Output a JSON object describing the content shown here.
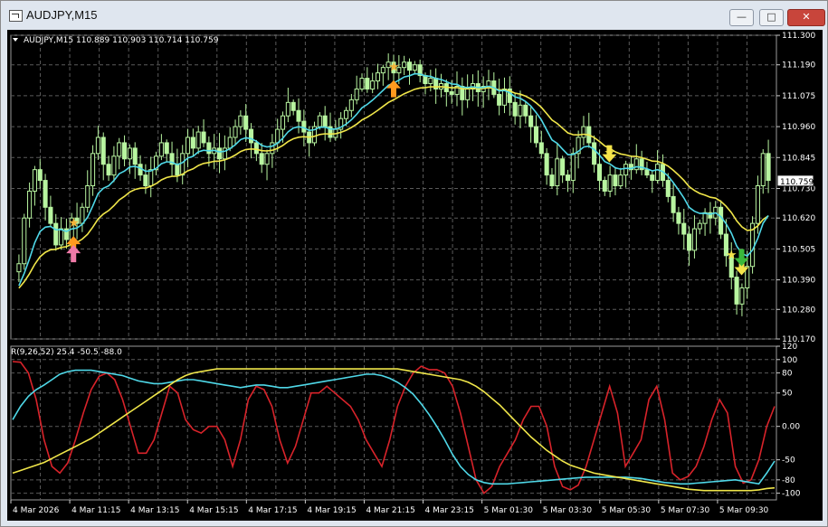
{
  "window": {
    "title": "AUDJPY,M15",
    "buttons": [
      "minimize",
      "maximize",
      "close"
    ]
  },
  "colors": {
    "background": "#000000",
    "grid": "#5a5a5a",
    "candle_up": "#b8f5a0",
    "ma_fast": "#4fd8e8",
    "ma_slow": "#f0e64a",
    "osc_red": "#d8232a",
    "osc_cyan": "#4fd8e8",
    "osc_yellow": "#f0e64a",
    "price_tag_bg": "#ffffff"
  },
  "chart_data": [
    {
      "type": "candlestick",
      "header": "AUDJPY,M15  110.889 110.903 110.714 110.759",
      "current_price": "110.759",
      "y_ticks": [
        "111.300",
        "111.190",
        "111.075",
        "110.960",
        "110.845",
        "110.730",
        "110.620",
        "110.505",
        "110.390",
        "110.280",
        "110.170"
      ],
      "ylim": [
        110.17,
        111.3
      ],
      "x_ticks": [
        "4 Mar 2026",
        "4 Mar 11:15",
        "4 Mar 13:15",
        "4 Mar 15:15",
        "4 Mar 17:15",
        "4 Mar 19:15",
        "4 Mar 21:15",
        "4 Mar 23:15",
        "5 Mar 01:30",
        "5 Mar 03:30",
        "5 Mar 05:30",
        "5 Mar 07:30",
        "5 Mar 09:30"
      ],
      "closes": [
        110.45,
        110.62,
        110.72,
        110.8,
        110.76,
        110.66,
        110.6,
        110.52,
        110.58,
        110.54,
        110.62,
        110.6,
        110.66,
        110.74,
        110.86,
        110.92,
        110.82,
        110.78,
        110.85,
        110.9,
        110.84,
        110.88,
        110.82,
        110.78,
        110.74,
        110.8,
        110.85,
        110.9,
        110.86,
        110.82,
        110.78,
        110.86,
        110.92,
        110.88,
        110.94,
        110.9,
        110.86,
        110.88,
        110.84,
        110.88,
        110.92,
        110.96,
        111.0,
        110.95,
        110.9,
        110.86,
        110.82,
        110.86,
        110.9,
        110.95,
        111.0,
        111.05,
        111.02,
        110.98,
        110.94,
        110.9,
        110.96,
        111.0,
        110.96,
        110.92,
        110.95,
        110.99,
        111.02,
        111.06,
        111.1,
        111.14,
        111.1,
        111.13,
        111.16,
        111.18,
        111.2,
        111.16,
        111.18,
        111.2,
        111.17,
        111.19,
        111.15,
        111.12,
        111.14,
        111.1,
        111.12,
        111.09,
        111.08,
        111.11,
        111.06,
        111.1,
        111.12,
        111.09,
        111.11,
        111.13,
        111.08,
        111.04,
        111.1,
        111.05,
        111.0,
        111.04,
        111.0,
        110.96,
        110.9,
        110.86,
        110.78,
        110.74,
        110.84,
        110.78,
        110.76,
        110.86,
        110.92,
        110.96,
        110.9,
        110.82,
        110.76,
        110.72,
        110.78,
        110.74,
        110.78,
        110.82,
        110.8,
        110.84,
        110.8,
        110.78,
        110.76,
        110.82,
        110.76,
        110.7,
        110.64,
        110.6,
        110.56,
        110.5,
        110.58,
        110.6,
        110.64,
        110.62,
        110.66,
        110.56,
        110.48,
        110.4,
        110.3,
        110.36,
        110.44,
        110.6,
        110.74,
        110.86,
        110.76
      ],
      "ma_fast_start": 110.35,
      "ma_slow_start": 110.35,
      "signals": [
        {
          "kind": "star",
          "color": "#f4b43a",
          "at": 18
        },
        {
          "kind": "arrow-up",
          "color": "#ff9a1e",
          "at": 18
        },
        {
          "kind": "arrow-up",
          "color": "#f07aa8",
          "at": 18
        },
        {
          "kind": "star",
          "color": "#f4b43a",
          "at": 110
        },
        {
          "kind": "arrow-up",
          "color": "#ff9a1e",
          "at": 110
        },
        {
          "kind": "star",
          "color": "#f4e44a",
          "at": 172
        },
        {
          "kind": "arrow-down",
          "color": "#f4e44a",
          "at": 172
        },
        {
          "kind": "star",
          "color": "#f4e44a",
          "at": 207
        },
        {
          "kind": "arrow-down",
          "color": "#f4e44a",
          "at": 210
        },
        {
          "kind": "arrow-down",
          "color": "#3ab83a",
          "at": 210
        }
      ]
    },
    {
      "type": "line",
      "header": "R(9,26,52) 25.4 -50.5 -88.0",
      "y_ticks": [
        "120",
        "100",
        "80",
        "50",
        "0.00",
        "-50",
        "-80",
        "-100"
      ],
      "ylim": [
        -110,
        120
      ],
      "series": [
        {
          "color": "#d8232a",
          "values": [
            97,
            96,
            80,
            40,
            -20,
            -60,
            -70,
            -55,
            -20,
            20,
            55,
            75,
            80,
            70,
            40,
            0,
            -40,
            -40,
            -20,
            20,
            60,
            50,
            10,
            -5,
            -10,
            0,
            0,
            -20,
            -60,
            -20,
            40,
            60,
            55,
            30,
            -20,
            -55,
            -30,
            10,
            50,
            50,
            60,
            50,
            40,
            30,
            10,
            -20,
            -40,
            -60,
            -20,
            30,
            60,
            80,
            90,
            85,
            85,
            80,
            60,
            20,
            -30,
            -80,
            -100,
            -90,
            -60,
            -40,
            -20,
            10,
            30,
            30,
            0,
            -60,
            -90,
            -95,
            -88,
            -60,
            -20,
            20,
            60,
            20,
            -60,
            -40,
            -20,
            40,
            60,
            10,
            -70,
            -80,
            -75,
            -60,
            -30,
            10,
            40,
            20,
            -60,
            -85,
            -80,
            -50,
            0,
            30
          ]
        },
        {
          "color": "#4fd8e8",
          "values": [
            10,
            30,
            45,
            55,
            62,
            70,
            78,
            82,
            84,
            84,
            84,
            82,
            80,
            78,
            76,
            72,
            68,
            66,
            64,
            64,
            66,
            68,
            70,
            70,
            68,
            66,
            64,
            62,
            60,
            58,
            60,
            62,
            62,
            60,
            58,
            58,
            60,
            62,
            64,
            66,
            68,
            70,
            72,
            74,
            76,
            78,
            78,
            76,
            72,
            66,
            58,
            48,
            34,
            18,
            0,
            -20,
            -42,
            -60,
            -72,
            -80,
            -84,
            -86,
            -86,
            -86,
            -85,
            -84,
            -83,
            -82,
            -81,
            -80,
            -79,
            -78,
            -77,
            -76,
            -76,
            -76,
            -76,
            -76,
            -76,
            -77,
            -78,
            -80,
            -82,
            -84,
            -85,
            -86,
            -86,
            -85,
            -84,
            -83,
            -82,
            -81,
            -80,
            -82,
            -84,
            -86,
            -70,
            -52
          ]
        },
        {
          "color": "#f0e64a",
          "values": [
            -70,
            -66,
            -62,
            -58,
            -54,
            -48,
            -42,
            -36,
            -30,
            -24,
            -18,
            -10,
            -2,
            6,
            14,
            22,
            30,
            38,
            46,
            54,
            62,
            70,
            76,
            80,
            82,
            84,
            86,
            86,
            86,
            86,
            86,
            86,
            86,
            86,
            86,
            86,
            86,
            86,
            86,
            86,
            86,
            86,
            86,
            86,
            86,
            86,
            86,
            86,
            86,
            86,
            84,
            82,
            80,
            78,
            76,
            74,
            72,
            70,
            66,
            60,
            52,
            42,
            32,
            20,
            8,
            -4,
            -16,
            -26,
            -36,
            -44,
            -52,
            -58,
            -62,
            -66,
            -70,
            -72,
            -74,
            -76,
            -78,
            -80,
            -82,
            -84,
            -86,
            -88,
            -90,
            -92,
            -94,
            -95,
            -96,
            -96,
            -96,
            -96,
            -96,
            -96,
            -96,
            -95,
            -93,
            -92
          ]
        }
      ]
    }
  ]
}
